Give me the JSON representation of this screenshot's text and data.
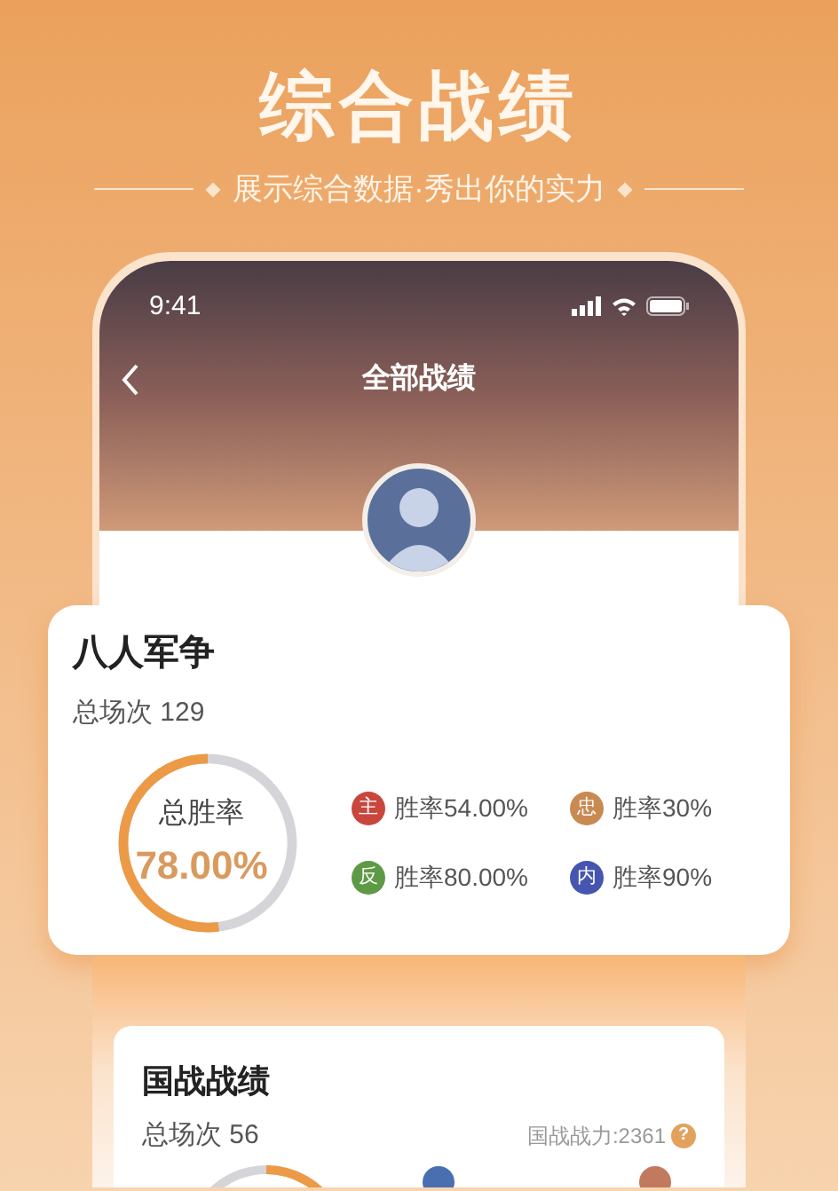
{
  "banner": {
    "title": "综合战绩",
    "subtitle": "展示综合数据·秀出你的实力"
  },
  "status_bar": {
    "time": "9:41"
  },
  "nav": {
    "title": "全部战绩"
  },
  "cards": [
    {
      "title": "八人军争",
      "total": "总场次 129",
      "ring": {
        "label": "总胜率",
        "value": "78.00%",
        "level": 0.52,
        "clockwise": false
      },
      "roles": [
        {
          "badge": "主",
          "text": "胜率54.00%",
          "color": "#c9463d"
        },
        {
          "badge": "忠",
          "text": "胜率30%",
          "color": "#c98a52"
        },
        {
          "badge": "反",
          "text": "胜率80.00%",
          "color": "#5e9a45"
        },
        {
          "badge": "内",
          "text": "胜率90%",
          "color": "#4656b0"
        }
      ]
    },
    {
      "title": "国战战绩",
      "total": "总场次 56",
      "power": "国战战力:2361",
      "help": "?",
      "roles": [
        {
          "color": "#4a6fb0"
        },
        {
          "color": "#c27a5e"
        }
      ]
    }
  ]
}
